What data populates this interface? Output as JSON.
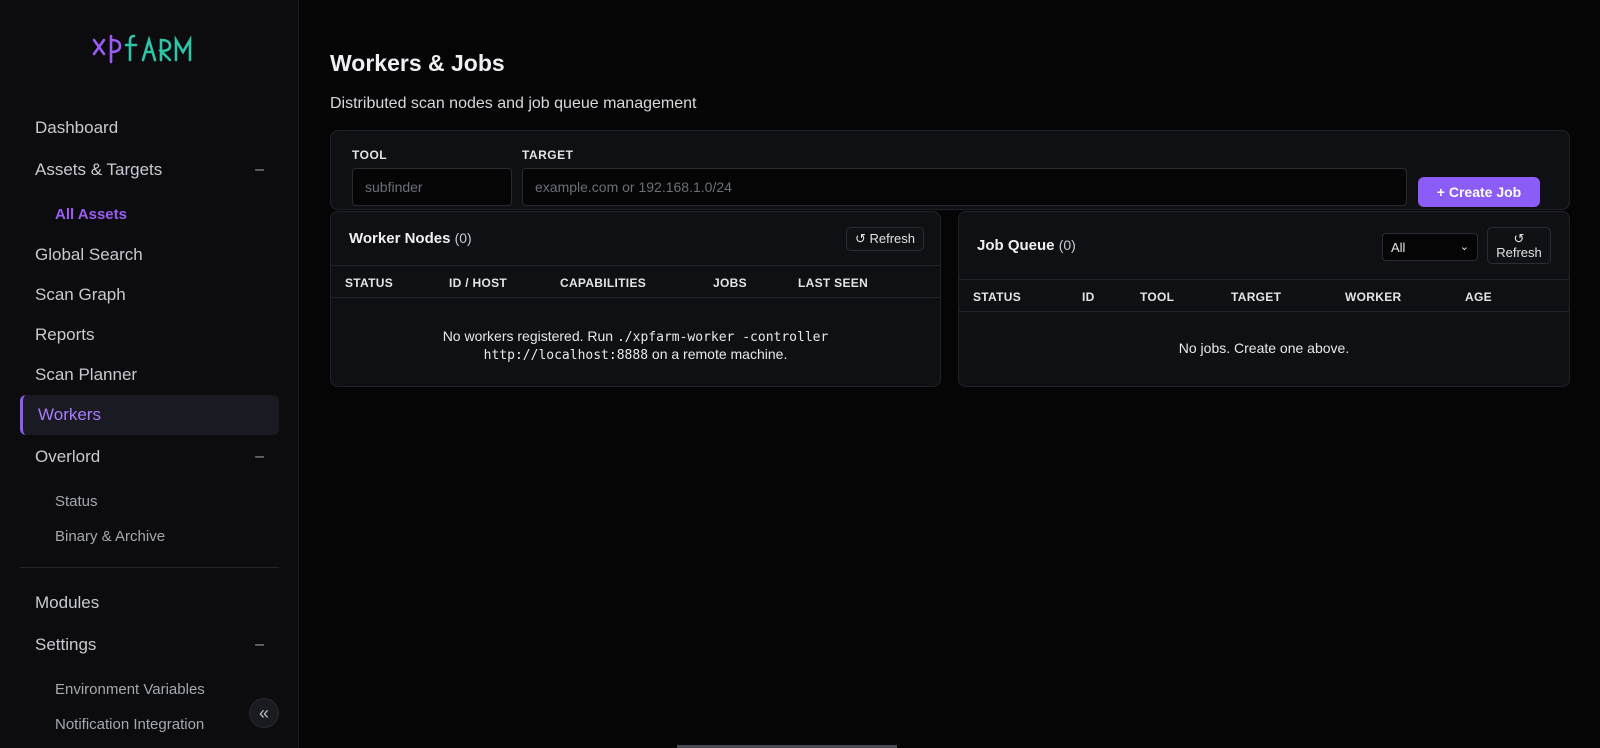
{
  "sidebar": {
    "logo": "xp farm",
    "items": [
      {
        "label": "Dashboard"
      },
      {
        "label": "Assets & Targets",
        "toggle": "–"
      },
      {
        "label": "All Assets"
      },
      {
        "label": "Global Search"
      },
      {
        "label": "Scan Graph"
      },
      {
        "label": "Reports"
      },
      {
        "label": "Scan Planner"
      },
      {
        "label": "Workers"
      },
      {
        "label": "Overlord",
        "toggle": "–"
      },
      {
        "label": "Status"
      },
      {
        "label": "Binary & Archive"
      },
      {
        "label": "Modules"
      },
      {
        "label": "Settings",
        "toggle": "–"
      },
      {
        "label": "Environment Variables"
      },
      {
        "label": "Notification Integration"
      }
    ],
    "collapse": "«"
  },
  "header": {
    "title": "Workers & Jobs",
    "subtitle": "Distributed scan nodes and job queue management"
  },
  "job_form": {
    "tool_label": "TOOL",
    "tool_placeholder": "subfinder",
    "target_label": "TARGET",
    "target_placeholder": "example.com or 192.168.1.0/24",
    "create_label": "+ Create Job"
  },
  "workers": {
    "title": "Worker Nodes",
    "count": "(0)",
    "refresh_label": "↺ Refresh",
    "columns": [
      "STATUS",
      "ID / HOST",
      "CAPABILITIES",
      "JOBS",
      "LAST SEEN"
    ],
    "empty_prefix": "No workers registered. Run ",
    "empty_cmd": "./xpfarm-worker -controller",
    "empty_url": "http://localhost:8888",
    "empty_suffix": " on a remote machine."
  },
  "jobs": {
    "title": "Job Queue",
    "count": "(0)",
    "filter_value": "All",
    "refresh_icon": "↺",
    "refresh_label": "Refresh",
    "columns": [
      "STATUS",
      "ID",
      "TOOL",
      "TARGET",
      "WORKER",
      "AGE"
    ],
    "empty": "No jobs. Create one above."
  },
  "colors": {
    "accent": "#8b5cf6",
    "logo_xp": "#9b5cf6",
    "logo_farm": "#2ec4a6",
    "background": "#050505"
  }
}
